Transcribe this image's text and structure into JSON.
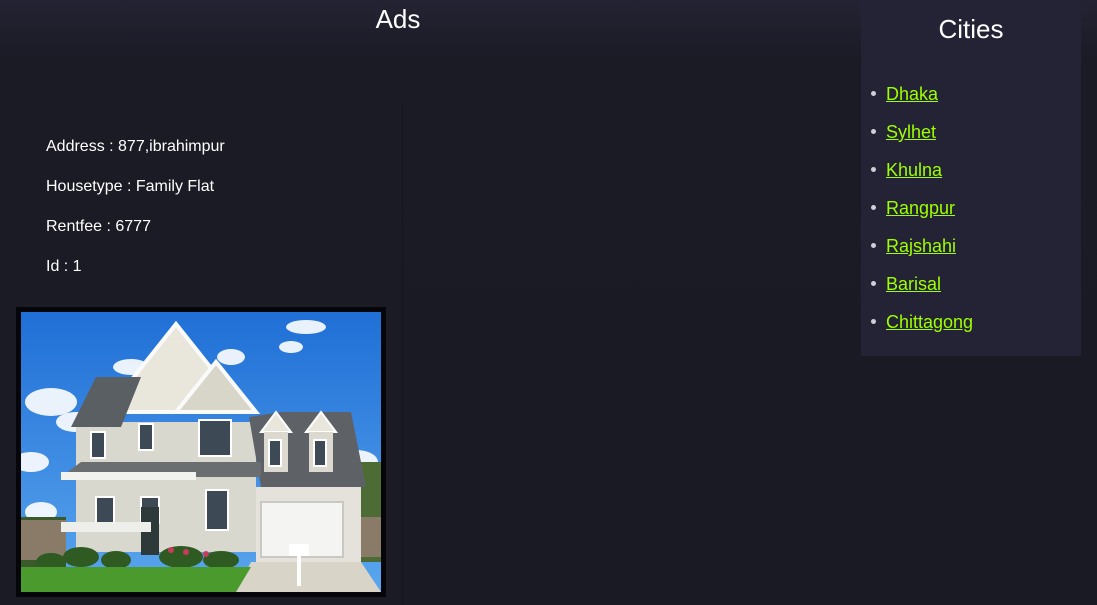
{
  "header": {
    "title": "Ads"
  },
  "ad": {
    "address": "Address : 877,ibrahimpur",
    "housetype": "Housetype : Family Flat",
    "rentfee": "Rentfee : 6777",
    "id": "Id : 1",
    "photo_icon": "house-photo"
  },
  "cities": {
    "title": "Cities",
    "items": [
      {
        "label": "Dhaka"
      },
      {
        "label": "Sylhet"
      },
      {
        "label": "Khulna"
      },
      {
        "label": "Rangpur"
      },
      {
        "label": "Rajshahi"
      },
      {
        "label": "Barisal"
      },
      {
        "label": "Chittagong"
      }
    ],
    "link_color": "#9dff00"
  },
  "colors": {
    "background": "#1a1a24",
    "sidebar": "#232335"
  }
}
